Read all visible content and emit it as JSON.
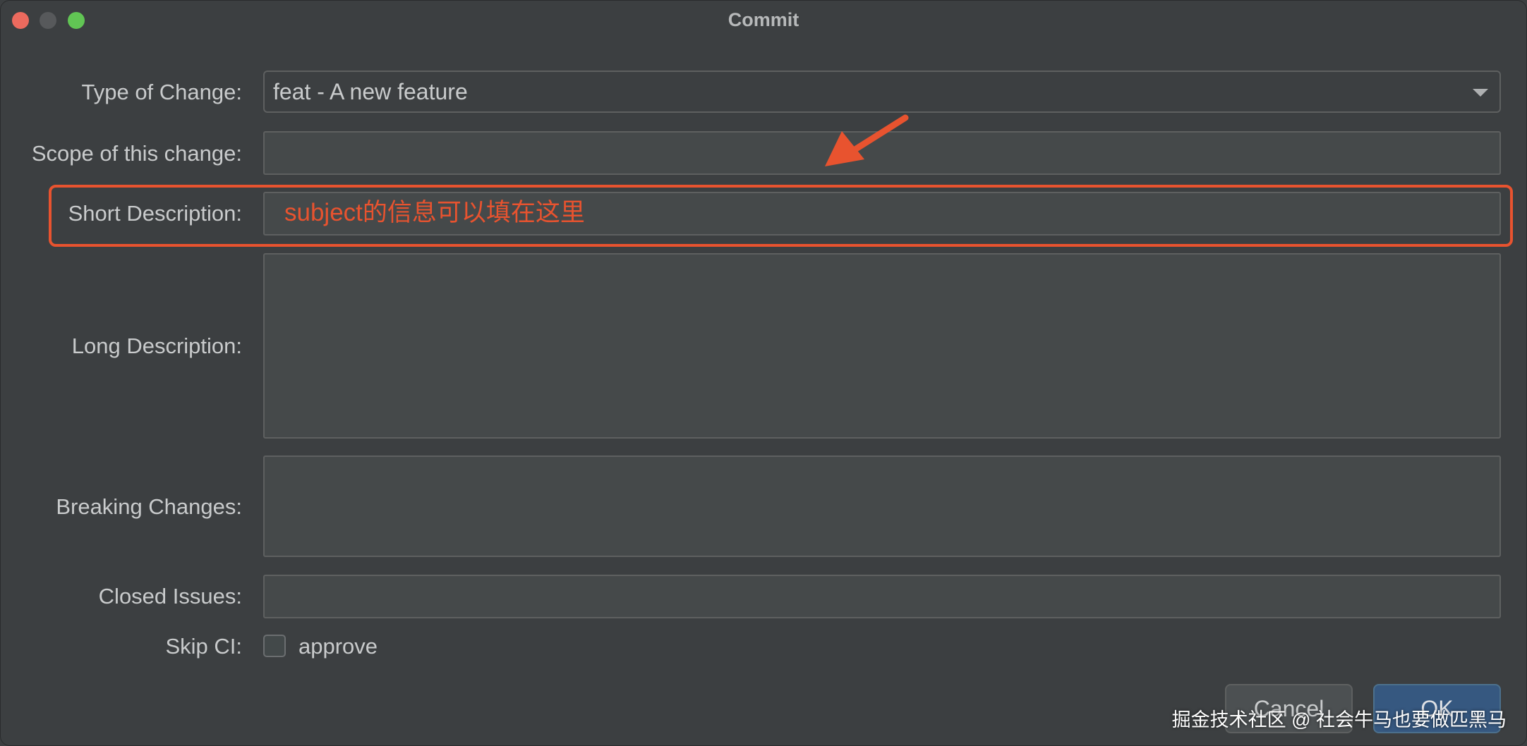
{
  "window": {
    "title": "Commit"
  },
  "form": {
    "type_label": "Type of Change:",
    "type_value": "feat - A new feature",
    "scope_label": "Scope of this change:",
    "scope_value": "",
    "short_label": "Short Description:",
    "short_value": "",
    "long_label": "Long Description:",
    "long_value": "",
    "breaking_label": "Breaking Changes:",
    "breaking_value": "",
    "closed_label": "Closed Issues:",
    "closed_value": "",
    "skip_ci_label": "Skip CI:",
    "skip_ci_checkbox_label": "approve",
    "skip_ci_checked": false
  },
  "buttons": {
    "cancel": "Cancel",
    "ok": "OK"
  },
  "annotation": {
    "text": "subject的信息可以填在这里",
    "color": "#e8532f"
  },
  "watermark": "掘金技术社区 @ 社会牛马也要做匹黑马"
}
